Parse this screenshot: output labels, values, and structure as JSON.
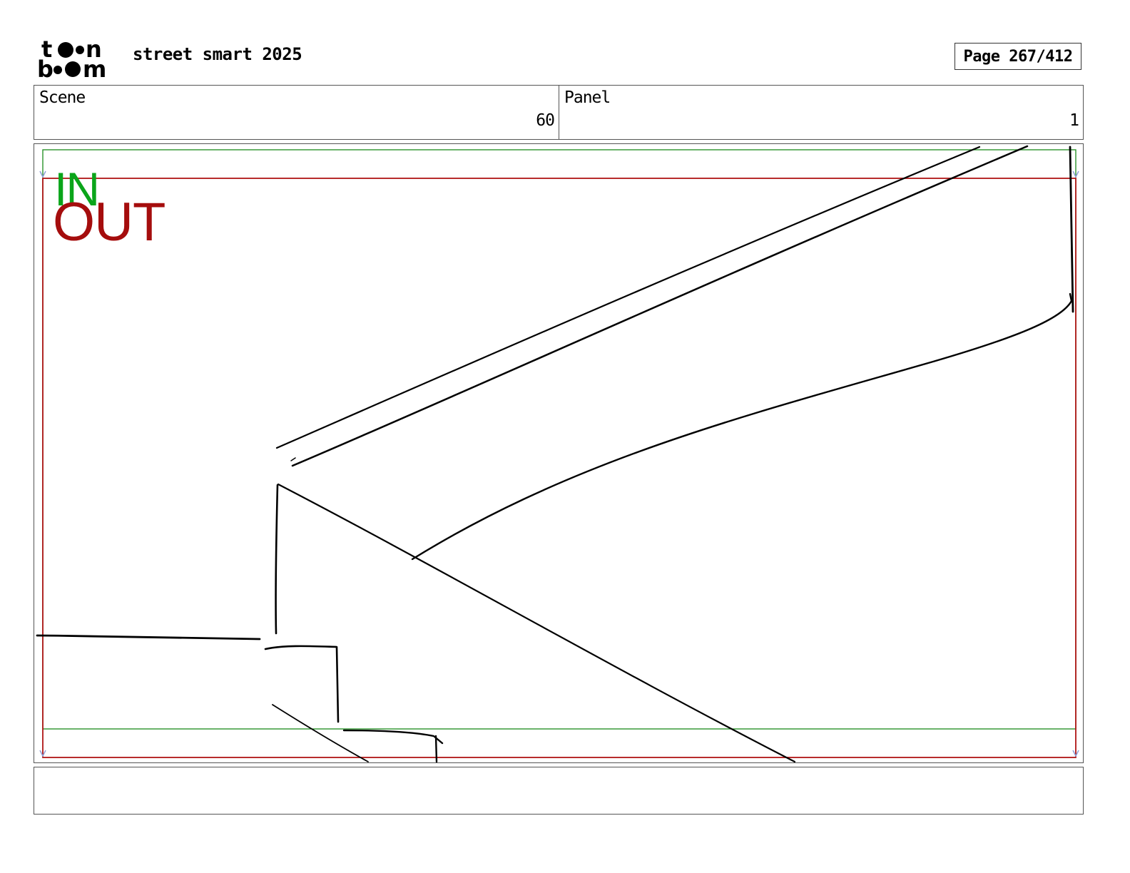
{
  "header": {
    "logo": {
      "line1": "toon",
      "line2": "boom",
      "icon": "toon-boom-logo"
    },
    "project_title": "street smart 2025",
    "page_label": "Page 267/412"
  },
  "info": {
    "scene_label": "Scene",
    "scene_value": "60",
    "panel_label": "Panel",
    "panel_value": "1"
  },
  "panel": {
    "in_label": "IN",
    "out_label": "OUT",
    "colors": {
      "in_frame": "#1a8a1a",
      "out_frame": "#b01515",
      "in_text": "#0aa51a",
      "out_text": "#a50d0d"
    }
  },
  "caption": {
    "text": ""
  }
}
